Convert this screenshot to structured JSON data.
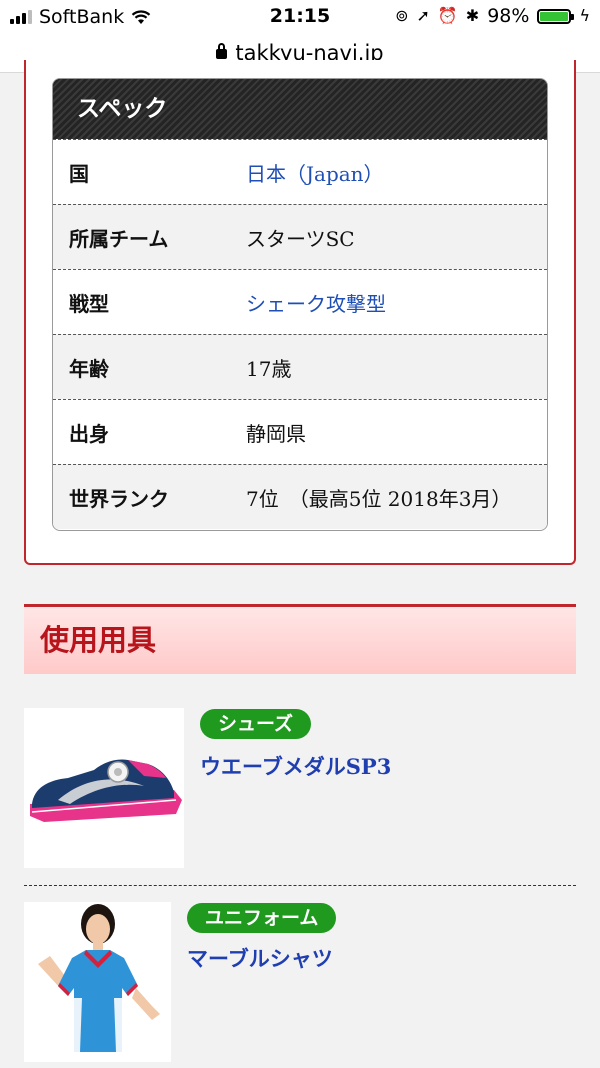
{
  "status_bar": {
    "carrier": "SoftBank",
    "time": "21:15",
    "battery": "98%",
    "battery_level": 0.98,
    "battery_color": "#35c235"
  },
  "url_bar": {
    "url": "takkyu-navi.jp"
  },
  "spec": {
    "title": "スペック",
    "rows": [
      {
        "label": "国",
        "value": "日本（Japan）"
      },
      {
        "label": "所属チーム",
        "value": "スターツSC"
      },
      {
        "label": "戦型",
        "value": "シェーク攻撃型"
      },
      {
        "label": "年齢",
        "value": "17歳"
      },
      {
        "label": "出身",
        "value": "静岡県"
      },
      {
        "label": "世界ランク",
        "value": "7位　（最高5位 2018年3月）"
      }
    ]
  },
  "equipment": {
    "heading": "使用用具",
    "items": [
      {
        "category": "シューズ",
        "name": "ウエーブメダルSP3"
      },
      {
        "category": "ユニフォーム",
        "name": "マーブルシャツ"
      }
    ]
  },
  "colors": {
    "accent_red": "#c0272d",
    "link_blue": "#1f4fb5",
    "tag_green": "#1f9a1f"
  }
}
